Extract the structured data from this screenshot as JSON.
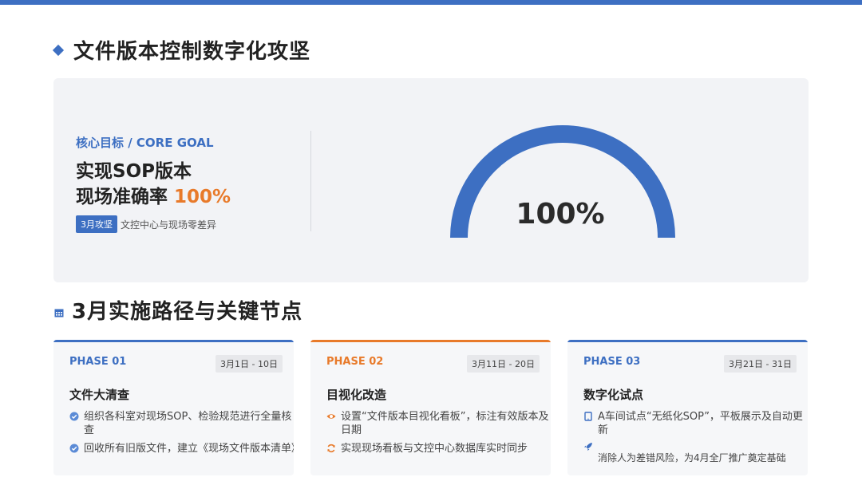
{
  "page": {
    "title": "文件版本控制数字化攻坚",
    "section2_title": "3月实施路径与关键节点"
  },
  "goal": {
    "kicker": "核心目标 / CORE GOAL",
    "line1": "实现SOP版本",
    "line2_prefix": "现场准确率 ",
    "line2_value": "100%",
    "badge": "3月攻坚",
    "badge_note": "文控中心与现场零差异",
    "gauge_value_text": "100%",
    "gauge_fraction": 1.0
  },
  "colors": {
    "accent_blue": "#3d6fc2",
    "accent_orange": "#e87a2a"
  },
  "phases": [
    {
      "label": "PHASE 01",
      "date": "3月1日 - 10日",
      "title": "文件大清查",
      "color": "#3d6fc2",
      "items": [
        {
          "icon": "check-circle-icon",
          "text": "组织各科室对现场SOP、检验规范进行全量核查"
        },
        {
          "icon": "check-circle-icon",
          "text": "回收所有旧版文件，建立《现场文件版本清单》"
        }
      ]
    },
    {
      "label": "PHASE 02",
      "date": "3月11日 - 20日",
      "title": "目视化改造",
      "color": "#e87a2a",
      "items": [
        {
          "icon": "eye-icon",
          "text": "设置“文件版本目视化看板”，标注有效版本及日期"
        },
        {
          "icon": "sync-icon",
          "text": "实现现场看板与文控中心数据库实时同步"
        }
      ]
    },
    {
      "label": "PHASE 03",
      "date": "3月21日 - 31日",
      "title": "数字化试点",
      "color": "#3d6fc2",
      "items": [
        {
          "icon": "tablet-icon",
          "text": "A车间试点“无纸化SOP”，平板展示及自动更新"
        },
        {
          "icon": "rocket-icon",
          "text": "消除人为差错风险，为4月全厂推广奠定基础"
        }
      ]
    }
  ]
}
